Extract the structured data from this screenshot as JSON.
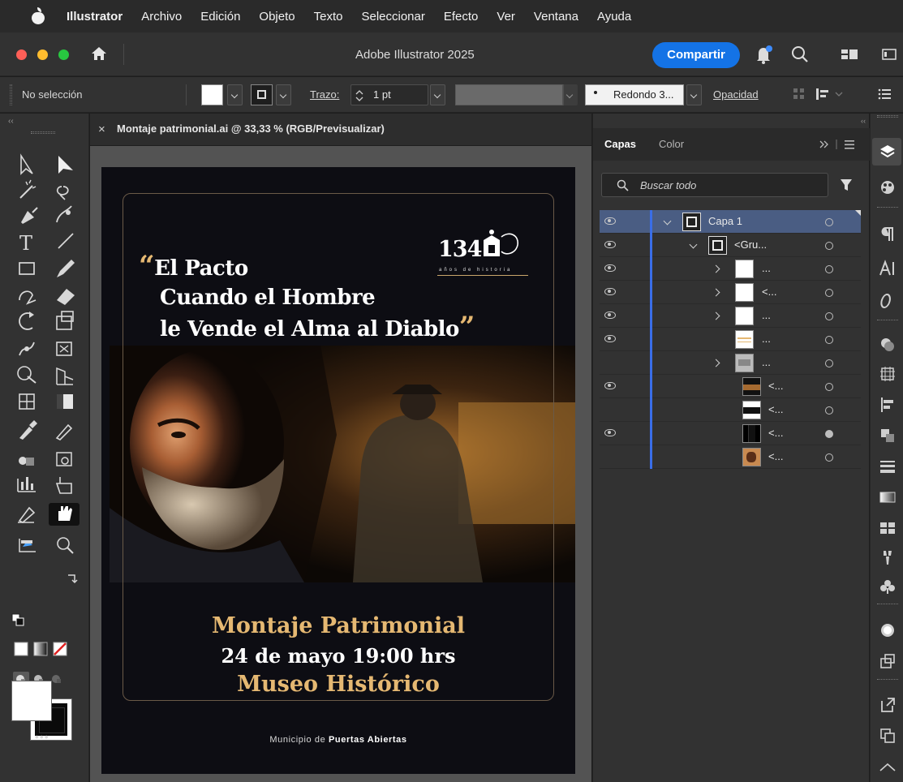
{
  "menubar": {
    "app": "Illustrator",
    "items": [
      "Archivo",
      "Edición",
      "Objeto",
      "Texto",
      "Seleccionar",
      "Efecto",
      "Ver",
      "Ventana",
      "Ayuda"
    ]
  },
  "titlebar": {
    "title": "Adobe Illustrator 2025",
    "share_label": "Compartir"
  },
  "controlbar": {
    "selection": "No selección",
    "stroke_label": "Trazo:",
    "stroke_value": "1 pt",
    "brush": "Redondo 3...",
    "opacity_label": "Opacidad"
  },
  "document": {
    "tab_close": "×",
    "tab_name": "Montaje patrimonial.ai @ 33,33 % (RGB/Previsualizar)"
  },
  "artwork": {
    "open_quote": "“",
    "title_lines": [
      "El Pacto",
      "Cuando el Hombre",
      "le Vende el Alma al Diablo"
    ],
    "close_quote": "”",
    "logo_number": "134",
    "logo_caption": "años de historia",
    "event_name": "Montaje Patrimonial",
    "event_date": "24 de mayo 19:00 hrs",
    "event_place": "Museo Histórico",
    "footer_prefix": "Municipio de",
    "footer_bold": "Puertas Abiertas",
    "colors": {
      "gold": "#e5b872",
      "bg": "#0d0d13"
    }
  },
  "layers_panel": {
    "tab_layers": "Capas",
    "tab_color": "Color",
    "search_placeholder": "Buscar todo",
    "rows": [
      {
        "name": "Capa 1",
        "visible": true
      },
      {
        "name": "<Gru...",
        "visible": true
      },
      {
        "name": "...",
        "visible": true
      },
      {
        "name": "<...",
        "visible": true
      },
      {
        "name": "...",
        "visible": true
      },
      {
        "name": "...",
        "visible": true
      },
      {
        "name": "...",
        "visible": false
      },
      {
        "name": "<...",
        "visible": true
      },
      {
        "name": "<...",
        "visible": false
      },
      {
        "name": "<...",
        "visible": true
      },
      {
        "name": "<...",
        "visible": false
      }
    ]
  },
  "toolbar": {
    "more": "•••"
  }
}
